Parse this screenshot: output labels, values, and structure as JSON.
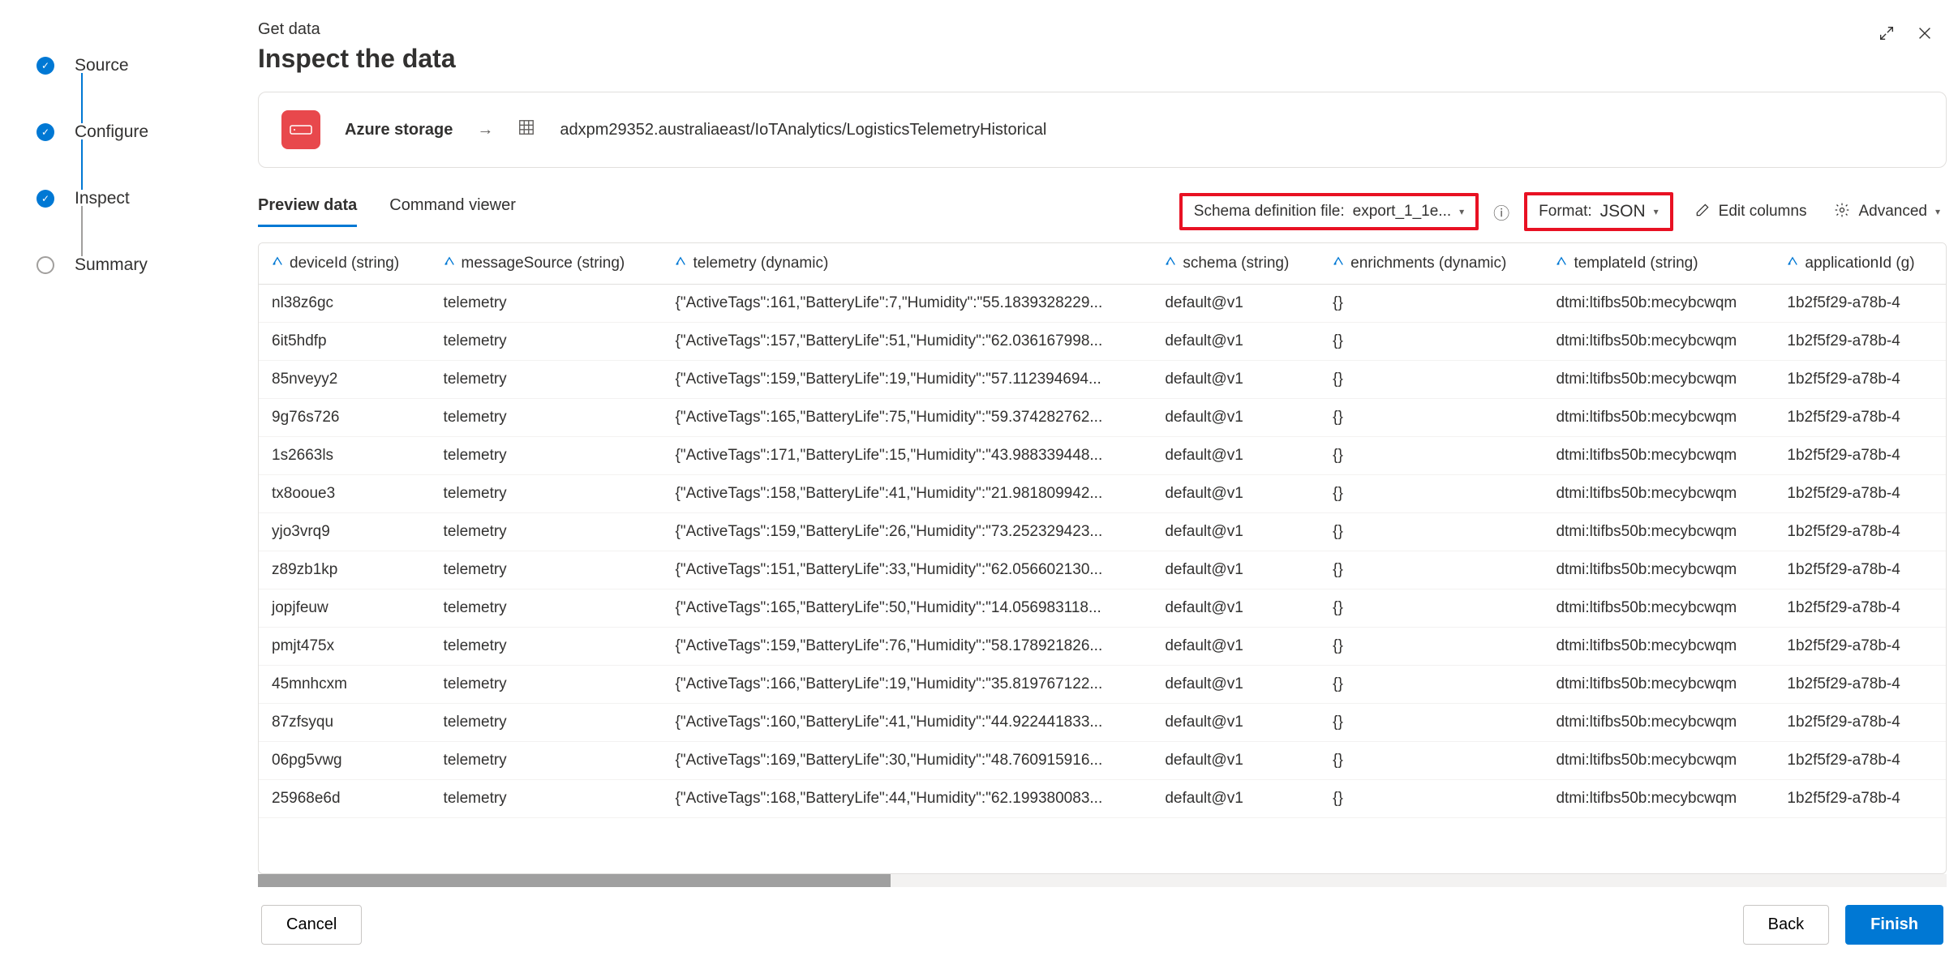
{
  "steps": [
    {
      "label": "Source",
      "state": "completed"
    },
    {
      "label": "Configure",
      "state": "completed"
    },
    {
      "label": "Inspect",
      "state": "completed"
    },
    {
      "label": "Summary",
      "state": "pending"
    }
  ],
  "header": {
    "breadcrumb": "Get data",
    "title": "Inspect the data"
  },
  "top_icons": {
    "expand": "expand-icon",
    "close": "close-icon"
  },
  "source": {
    "service": "Azure storage",
    "path": "adxpm29352.australiaeast/IoTAnalytics/LogisticsTelemetryHistorical"
  },
  "tabs": [
    {
      "label": "Preview data",
      "active": true
    },
    {
      "label": "Command viewer",
      "active": false
    }
  ],
  "toolbar": {
    "schema_label": "Schema definition file:",
    "schema_value": "export_1_1e...",
    "format_label": "Format:",
    "format_value": "JSON",
    "edit_columns": "Edit columns",
    "advanced": "Advanced"
  },
  "columns": [
    {
      "name": "deviceId",
      "type": "string"
    },
    {
      "name": "messageSource",
      "type": "string"
    },
    {
      "name": "telemetry",
      "type": "dynamic"
    },
    {
      "name": "schema",
      "type": "string"
    },
    {
      "name": "enrichments",
      "type": "dynamic"
    },
    {
      "name": "templateId",
      "type": "string"
    },
    {
      "name": "applicationId",
      "type": "g"
    }
  ],
  "rows": [
    {
      "deviceId": "nl38z6gc",
      "messageSource": "telemetry",
      "telemetry": "{\"ActiveTags\":161,\"BatteryLife\":7,\"Humidity\":\"55.1839328229...",
      "schema": "default@v1",
      "enrichments": "{}",
      "templateId": "dtmi:ltifbs50b:mecybcwqm",
      "applicationId": "1b2f5f29-a78b-4"
    },
    {
      "deviceId": "6it5hdfp",
      "messageSource": "telemetry",
      "telemetry": "{\"ActiveTags\":157,\"BatteryLife\":51,\"Humidity\":\"62.036167998...",
      "schema": "default@v1",
      "enrichments": "{}",
      "templateId": "dtmi:ltifbs50b:mecybcwqm",
      "applicationId": "1b2f5f29-a78b-4"
    },
    {
      "deviceId": "85nveyy2",
      "messageSource": "telemetry",
      "telemetry": "{\"ActiveTags\":159,\"BatteryLife\":19,\"Humidity\":\"57.112394694...",
      "schema": "default@v1",
      "enrichments": "{}",
      "templateId": "dtmi:ltifbs50b:mecybcwqm",
      "applicationId": "1b2f5f29-a78b-4"
    },
    {
      "deviceId": "9g76s726",
      "messageSource": "telemetry",
      "telemetry": "{\"ActiveTags\":165,\"BatteryLife\":75,\"Humidity\":\"59.374282762...",
      "schema": "default@v1",
      "enrichments": "{}",
      "templateId": "dtmi:ltifbs50b:mecybcwqm",
      "applicationId": "1b2f5f29-a78b-4"
    },
    {
      "deviceId": "1s2663ls",
      "messageSource": "telemetry",
      "telemetry": "{\"ActiveTags\":171,\"BatteryLife\":15,\"Humidity\":\"43.988339448...",
      "schema": "default@v1",
      "enrichments": "{}",
      "templateId": "dtmi:ltifbs50b:mecybcwqm",
      "applicationId": "1b2f5f29-a78b-4"
    },
    {
      "deviceId": "tx8ooue3",
      "messageSource": "telemetry",
      "telemetry": "{\"ActiveTags\":158,\"BatteryLife\":41,\"Humidity\":\"21.981809942...",
      "schema": "default@v1",
      "enrichments": "{}",
      "templateId": "dtmi:ltifbs50b:mecybcwqm",
      "applicationId": "1b2f5f29-a78b-4"
    },
    {
      "deviceId": "yjo3vrq9",
      "messageSource": "telemetry",
      "telemetry": "{\"ActiveTags\":159,\"BatteryLife\":26,\"Humidity\":\"73.252329423...",
      "schema": "default@v1",
      "enrichments": "{}",
      "templateId": "dtmi:ltifbs50b:mecybcwqm",
      "applicationId": "1b2f5f29-a78b-4"
    },
    {
      "deviceId": "z89zb1kp",
      "messageSource": "telemetry",
      "telemetry": "{\"ActiveTags\":151,\"BatteryLife\":33,\"Humidity\":\"62.056602130...",
      "schema": "default@v1",
      "enrichments": "{}",
      "templateId": "dtmi:ltifbs50b:mecybcwqm",
      "applicationId": "1b2f5f29-a78b-4"
    },
    {
      "deviceId": "jopjfeuw",
      "messageSource": "telemetry",
      "telemetry": "{\"ActiveTags\":165,\"BatteryLife\":50,\"Humidity\":\"14.056983118...",
      "schema": "default@v1",
      "enrichments": "{}",
      "templateId": "dtmi:ltifbs50b:mecybcwqm",
      "applicationId": "1b2f5f29-a78b-4"
    },
    {
      "deviceId": "pmjt475x",
      "messageSource": "telemetry",
      "telemetry": "{\"ActiveTags\":159,\"BatteryLife\":76,\"Humidity\":\"58.178921826...",
      "schema": "default@v1",
      "enrichments": "{}",
      "templateId": "dtmi:ltifbs50b:mecybcwqm",
      "applicationId": "1b2f5f29-a78b-4"
    },
    {
      "deviceId": "45mnhcxm",
      "messageSource": "telemetry",
      "telemetry": "{\"ActiveTags\":166,\"BatteryLife\":19,\"Humidity\":\"35.819767122...",
      "schema": "default@v1",
      "enrichments": "{}",
      "templateId": "dtmi:ltifbs50b:mecybcwqm",
      "applicationId": "1b2f5f29-a78b-4"
    },
    {
      "deviceId": "87zfsyqu",
      "messageSource": "telemetry",
      "telemetry": "{\"ActiveTags\":160,\"BatteryLife\":41,\"Humidity\":\"44.922441833...",
      "schema": "default@v1",
      "enrichments": "{}",
      "templateId": "dtmi:ltifbs50b:mecybcwqm",
      "applicationId": "1b2f5f29-a78b-4"
    },
    {
      "deviceId": "06pg5vwg",
      "messageSource": "telemetry",
      "telemetry": "{\"ActiveTags\":169,\"BatteryLife\":30,\"Humidity\":\"48.760915916...",
      "schema": "default@v1",
      "enrichments": "{}",
      "templateId": "dtmi:ltifbs50b:mecybcwqm",
      "applicationId": "1b2f5f29-a78b-4"
    },
    {
      "deviceId": "25968e6d",
      "messageSource": "telemetry",
      "telemetry": "{\"ActiveTags\":168,\"BatteryLife\":44,\"Humidity\":\"62.199380083...",
      "schema": "default@v1",
      "enrichments": "{}",
      "templateId": "dtmi:ltifbs50b:mecybcwqm",
      "applicationId": "1b2f5f29-a78b-4"
    }
  ],
  "footer": {
    "cancel": "Cancel",
    "back": "Back",
    "finish": "Finish"
  }
}
